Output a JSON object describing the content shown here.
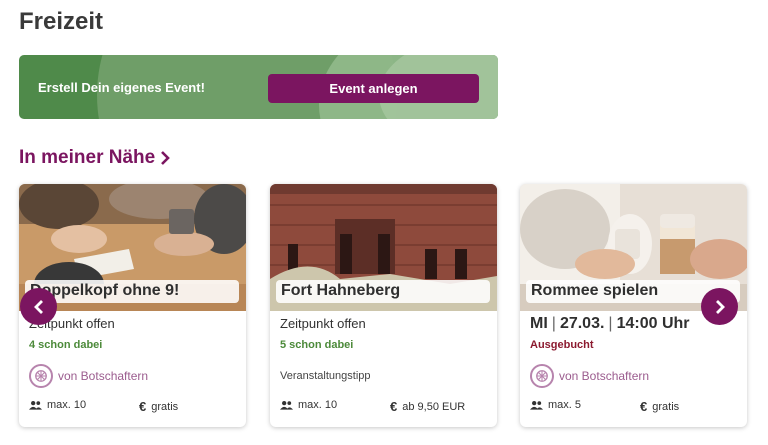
{
  "page": {
    "title": "Freizeit"
  },
  "banner": {
    "text": "Erstell Dein eigenes Event!",
    "button_label": "Event anlegen"
  },
  "section": {
    "title": "In meiner Nähe"
  },
  "colors": {
    "brand": "#7b1560",
    "banner_green": "#4f8a4a",
    "status_green": "#4c8a3a",
    "status_red": "#8c1a2f"
  },
  "cards": [
    {
      "title": "Doppelkopf ohne 9!",
      "when": "Zeitpunkt offen",
      "status": "4 schon dabei",
      "owner": "von Botschaftern",
      "capacity": "max. 10",
      "price": "gratis"
    },
    {
      "title": "Fort Hahneberg",
      "when": "Zeitpunkt offen",
      "status": "5 schon dabei",
      "tip": "Veranstaltungstipp",
      "capacity": "max. 10",
      "price": "ab 9,50 EUR"
    },
    {
      "title": "Rommee spielen",
      "date_day": "MI",
      "date_date": "27.03.",
      "date_time": "14:00 Uhr",
      "status": "Ausgebucht",
      "owner": "von Botschaftern",
      "capacity": "max. 5",
      "price": "gratis"
    }
  ],
  "icons": {
    "prev": "chevron-left-icon",
    "next": "chevron-right-icon",
    "people": "people-icon",
    "euro": "euro-icon",
    "badge": "ambassador-badge-icon"
  }
}
